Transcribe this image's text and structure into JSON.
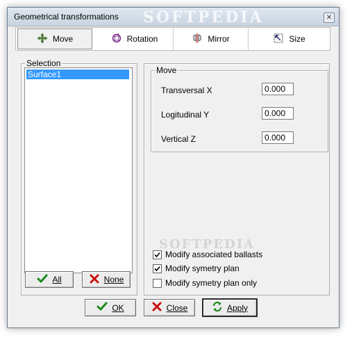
{
  "window": {
    "title": "Geometrical transformations",
    "close_label": "✕",
    "watermark": "SOFTPEDIA"
  },
  "tabs": [
    {
      "label": "Move",
      "icon": "move-icon",
      "active": true
    },
    {
      "label": "Rotation",
      "icon": "rotation-icon"
    },
    {
      "label": "Mirror",
      "icon": "mirror-icon"
    },
    {
      "label": "Size",
      "icon": "size-icon"
    }
  ],
  "selection": {
    "legend": "Selection",
    "items": [
      "Surface1"
    ],
    "all_label": "All",
    "none_label": "None"
  },
  "move": {
    "legend": "Move",
    "fields": [
      {
        "label": "Transversal X",
        "value": "0.000"
      },
      {
        "label": "Logitudinal Y",
        "value": "0.000"
      },
      {
        "label": "Vertical Z",
        "value": "0.000"
      }
    ]
  },
  "options": [
    {
      "label": "Modify associated ballasts",
      "checked": true
    },
    {
      "label": "Modify symetry plan",
      "checked": true
    },
    {
      "label": "Modify symetry plan only",
      "checked": false
    }
  ],
  "footer": {
    "ok_label": "OK",
    "close_label": "Close",
    "apply_label": "Apply"
  },
  "colors": {
    "selection_bg": "#3399ff",
    "check_green": "#1a8a1a",
    "cross_red": "#cc1111"
  }
}
